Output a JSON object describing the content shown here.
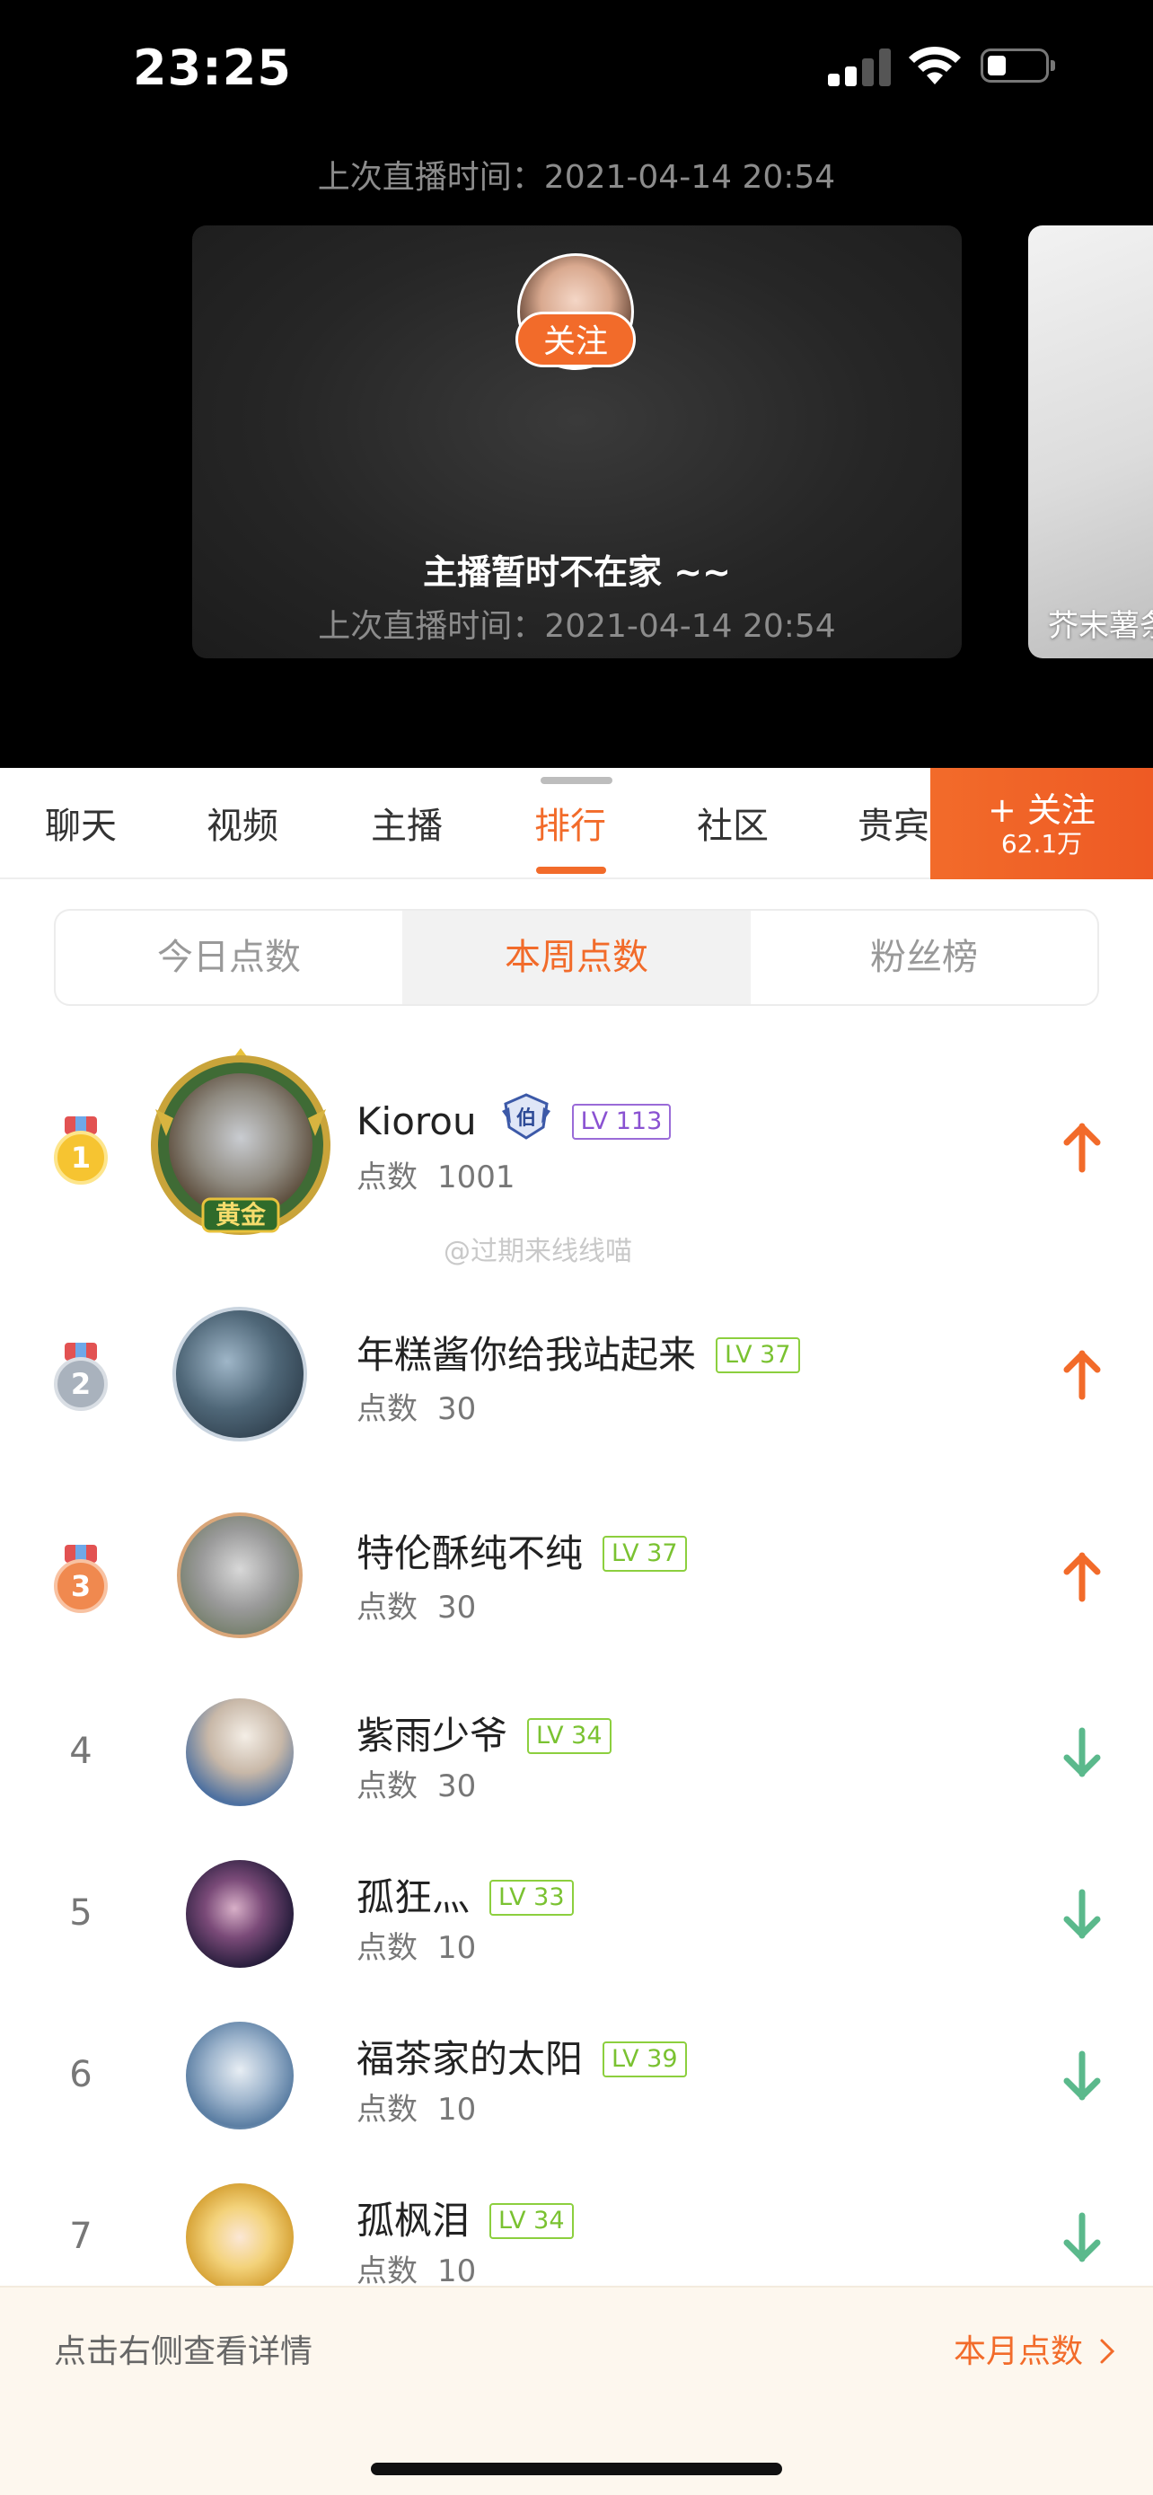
{
  "status_bar": {
    "time": "23:25",
    "battery_icon": "battery-low-icon",
    "wifi_icon": "wifi-icon",
    "signal_icon": "signal-icon"
  },
  "live": {
    "last_live_text": "上次直播时间：2021-04-14 20:54",
    "follow_label": "关注",
    "offline_title": "主播暂时不在家 ~~",
    "card_last_live": "上次直播时间：2021-04-14 20:54",
    "next_card_label": "芥末薯条"
  },
  "tabs": [
    {
      "label": "聊天",
      "active": false
    },
    {
      "label": "视频",
      "active": false
    },
    {
      "label": "主播",
      "active": false
    },
    {
      "label": "排行",
      "active": true
    },
    {
      "label": "社区",
      "active": false
    },
    {
      "label": "贵宾",
      "active": false
    }
  ],
  "follow_button": {
    "label": "+ 关注",
    "count": "62.1万"
  },
  "ranking_tabs": [
    {
      "label": "今日点数",
      "active": false
    },
    {
      "label": "本周点数",
      "active": true
    },
    {
      "label": "粉丝榜",
      "active": false
    }
  ],
  "score_label": "点数",
  "watermark": "@过期来线线喵",
  "rankings": [
    {
      "rank": "1",
      "name": "Kiorou",
      "level": "LV 113",
      "score": "1001",
      "trend": "up",
      "frame_text": "黄金",
      "noble_badge": "伯"
    },
    {
      "rank": "2",
      "name": "年糕酱你给我站起来",
      "level": "LV 37",
      "score": "30",
      "trend": "up"
    },
    {
      "rank": "3",
      "name": "特伦酥纯不纯",
      "level": "LV 37",
      "score": "30",
      "trend": "up"
    },
    {
      "rank": "4",
      "name": "紫雨少爷",
      "level": "LV 34",
      "score": "30",
      "trend": "down"
    },
    {
      "rank": "5",
      "name": "孤狂灬",
      "level": "LV 33",
      "score": "10",
      "trend": "down"
    },
    {
      "rank": "6",
      "name": "福茶家的太阳",
      "level": "LV 39",
      "score": "10",
      "trend": "down"
    },
    {
      "rank": "7",
      "name": "孤枫泪",
      "level": "LV 34",
      "score": "10",
      "trend": "down"
    }
  ],
  "footer": {
    "hint": "点击右侧查看详情",
    "link_label": "本月点数"
  },
  "colors": {
    "accent": "#f26b2a",
    "up": "#f26b2a",
    "down": "#5bb98c",
    "level_green": "#7ac231",
    "level_purple": "#8a52d2"
  }
}
